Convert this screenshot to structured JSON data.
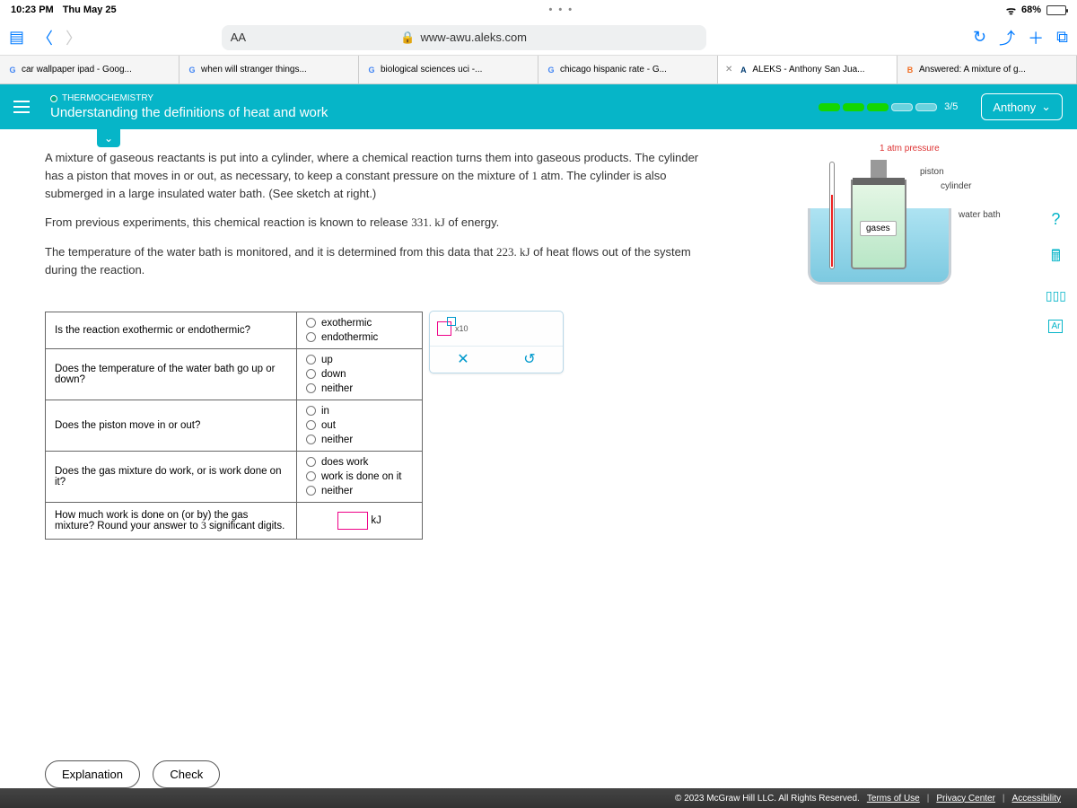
{
  "status": {
    "time": "10:23 PM",
    "date": "Thu May 25",
    "battery": "68%",
    "center_dots": "• • •"
  },
  "safari": {
    "aa": "AA",
    "url": "www-awu.aleks.com"
  },
  "browser_tabs": [
    {
      "label": "car wallpaper ipad - Goog...",
      "icon": "G",
      "icon_color": "#4285f4"
    },
    {
      "label": "when will stranger things...",
      "icon": "G",
      "icon_color": "#4285f4"
    },
    {
      "label": "biological sciences uci -...",
      "icon": "G",
      "icon_color": "#4285f4"
    },
    {
      "label": "chicago hispanic rate - G...",
      "icon": "G",
      "icon_color": "#4285f4"
    },
    {
      "label": "ALEKS - Anthony San Jua...",
      "icon": "A",
      "icon_color": "#003b71",
      "active": true,
      "closeable": true
    },
    {
      "label": "Answered: A mixture of g...",
      "icon": "B",
      "icon_color": "#f26d21"
    }
  ],
  "header": {
    "chip": "THERMOCHEMISTRY",
    "title": "Understanding the definitions of heat and work",
    "progress": "3/5",
    "user": "Anthony"
  },
  "problem": {
    "p1a": "A mixture of gaseous reactants is put into a cylinder, where a chemical reaction turns them into gaseous products. The cylinder has a piston that moves in or out, as necessary, to keep a constant pressure on the mixture of ",
    "p1_num": "1",
    "p1b": " atm. The cylinder is also submerged in a large insulated water bath. (See sketch at right.)",
    "p2a": "From previous experiments, this chemical reaction is known to release ",
    "p2_num": "331. kJ",
    "p2b": " of energy.",
    "p3a": "The temperature of the water bath is monitored, and it is determined from this data that ",
    "p3_num": "223. kJ",
    "p3b": " of heat flows out of the system during the reaction."
  },
  "diagram": {
    "pressure": "1 atm pressure",
    "piston": "piston",
    "cylinder": "cylinder",
    "waterbath": "water bath",
    "gases": "gases"
  },
  "questions": [
    {
      "q": "Is the reaction exothermic or endothermic?",
      "opts": [
        "exothermic",
        "endothermic"
      ]
    },
    {
      "q": "Does the temperature of the water bath go up or down?",
      "opts": [
        "up",
        "down",
        "neither"
      ]
    },
    {
      "q": "Does the piston move in or out?",
      "opts": [
        "in",
        "out",
        "neither"
      ]
    },
    {
      "q": "Does the gas mixture do work, or is work done on it?",
      "opts": [
        "does work",
        "work is done on it",
        "neither"
      ]
    }
  ],
  "q5": {
    "q": "How much work is done on (or by) the gas mixture? Round your answer to 3 significant digits.",
    "unit": "kJ"
  },
  "palette": {
    "x10": "x10",
    "close": "✕",
    "undo": "↺"
  },
  "buttons": {
    "explanation": "Explanation",
    "check": "Check"
  },
  "footer": {
    "copy": "© 2023 McGraw Hill LLC. All Rights Reserved.",
    "terms": "Terms of Use",
    "privacy": "Privacy Center",
    "access": "Accessibility"
  }
}
